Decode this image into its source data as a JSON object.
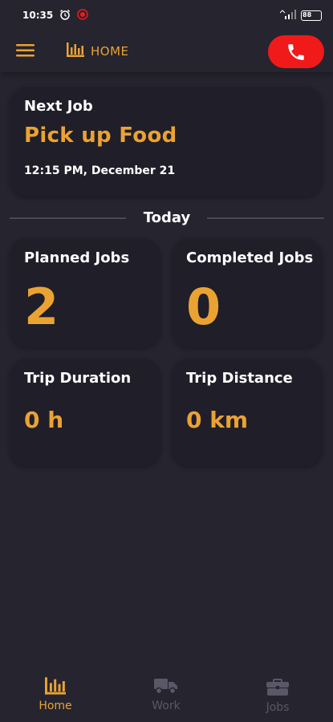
{
  "status_bar": {
    "time": "10:35",
    "battery": "88"
  },
  "header": {
    "title": "HOME"
  },
  "next_job": {
    "label": "Next Job",
    "title": "Pick up Food",
    "time": "12:15 PM, December 21"
  },
  "today": {
    "label": "Today"
  },
  "stats": {
    "planned": {
      "label": "Planned Jobs",
      "value": "2"
    },
    "completed": {
      "label": "Completed Jobs",
      "value": "0"
    },
    "duration": {
      "label": "Trip Duration",
      "value": "0 h"
    },
    "distance": {
      "label": "Trip Distance",
      "value": "0 km"
    }
  },
  "bottom_nav": [
    {
      "label": "Home",
      "icon": "bar-chart-icon",
      "active": true
    },
    {
      "label": "Work",
      "icon": "truck-icon",
      "active": false
    },
    {
      "label": "Jobs",
      "icon": "briefcase-icon",
      "active": false
    }
  ],
  "colors": {
    "accent": "#eaa332",
    "call": "#f01a1a",
    "background": "#26242f",
    "card": "#201e29",
    "inactive": "#5a5866"
  }
}
